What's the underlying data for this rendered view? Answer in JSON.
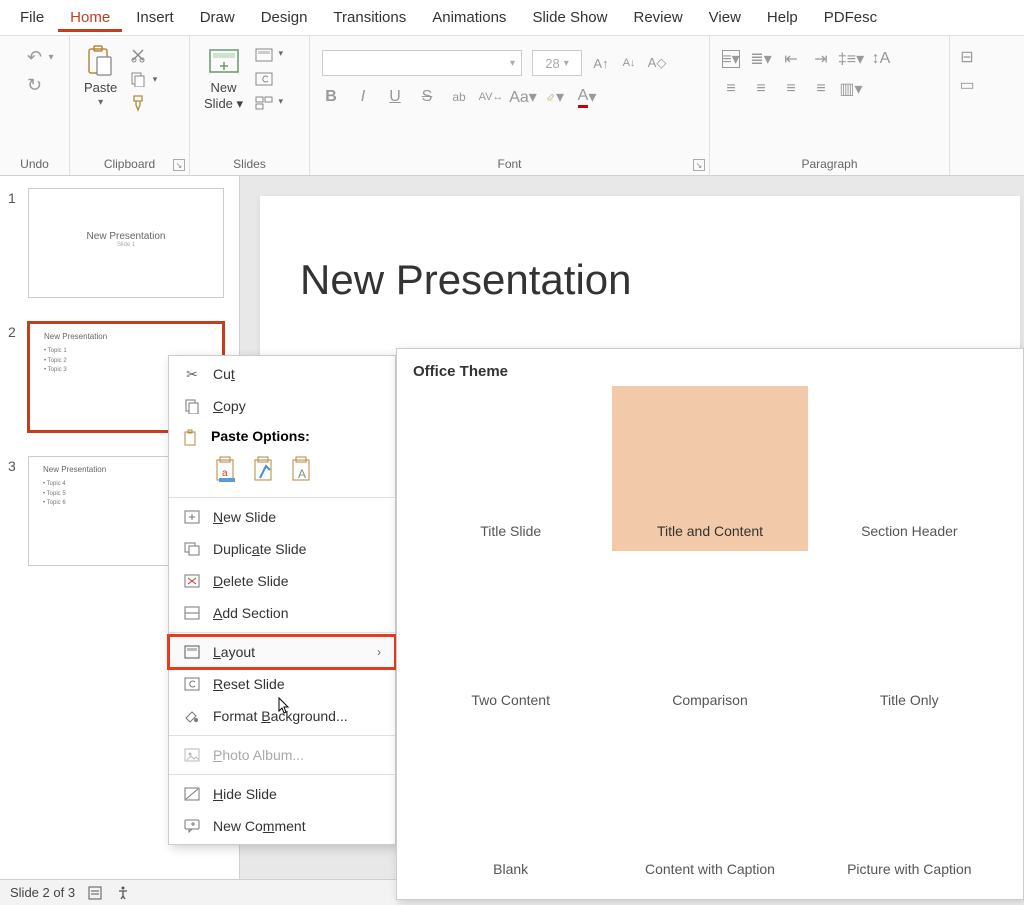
{
  "menubar": {
    "items": [
      "File",
      "Home",
      "Insert",
      "Draw",
      "Design",
      "Transitions",
      "Animations",
      "Slide Show",
      "Review",
      "View",
      "Help",
      "PDFesc"
    ],
    "active_index": 1
  },
  "ribbon": {
    "undo_label": "Undo",
    "clipboard_label": "Clipboard",
    "paste_label": "Paste",
    "slides_label": "Slides",
    "new_slide_label": "New\nSlide",
    "font_label": "Font",
    "font_size": "28",
    "paragraph_label": "Paragraph"
  },
  "thumbnails": {
    "slides": [
      {
        "number": "1",
        "title": "New Presentation",
        "subtitle": "Slide 1",
        "bullets": []
      },
      {
        "number": "2",
        "title": "New Presentation",
        "bullets": [
          "Topic 1",
          "Topic 2",
          "Topic 3"
        ],
        "selected": true
      },
      {
        "number": "3",
        "title": "New Presentation",
        "bullets": [
          "Topic 4",
          "Topic 5",
          "Topic 6"
        ]
      }
    ]
  },
  "slide": {
    "title": "New Presentation"
  },
  "context_menu": {
    "cut": "Cut",
    "copy": "Copy",
    "paste_options_header": "Paste Options:",
    "new_slide": "New Slide",
    "duplicate_slide": "Duplicate Slide",
    "delete_slide": "Delete Slide",
    "add_section": "Add Section",
    "layout": "Layout",
    "reset_slide": "Reset Slide",
    "format_background": "Format Background...",
    "photo_album": "Photo Album...",
    "hide_slide": "Hide Slide",
    "new_comment": "New Comment"
  },
  "layout_flyout": {
    "header": "Office Theme",
    "options": [
      {
        "label": "Title Slide"
      },
      {
        "label": "Title and Content",
        "selected": true
      },
      {
        "label": "Section Header"
      },
      {
        "label": "Two Content"
      },
      {
        "label": "Comparison"
      },
      {
        "label": "Title Only"
      },
      {
        "label": "Blank"
      },
      {
        "label": "Content with Caption"
      },
      {
        "label": "Picture with Caption"
      }
    ]
  },
  "statusbar": {
    "text": "Slide 2 of 3"
  }
}
